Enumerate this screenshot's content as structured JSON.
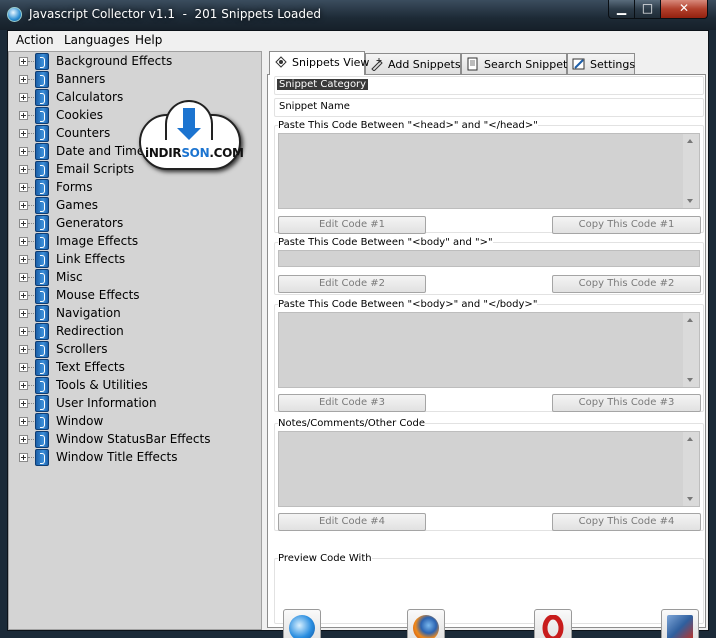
{
  "window": {
    "title": "Javascript Collector v1.1  -  201 Snippets Loaded",
    "minimize": "▁",
    "maximize": "□",
    "close": "✕"
  },
  "menu": [
    "Action",
    "Languages",
    "Help"
  ],
  "tree": {
    "items": [
      "Background Effects",
      "Banners",
      "Calculators",
      "Cookies",
      "Counters",
      "Date and Time",
      "Email Scripts",
      "Forms",
      "Games",
      "Generators",
      "Image Effects",
      "Link Effects",
      "Misc",
      "Mouse Effects",
      "Navigation",
      "Redirection",
      "Scrollers",
      "Text Effects",
      "Tools & Utilities",
      "User Information",
      "Window",
      "Window StatusBar Effects",
      "Window Title Effects"
    ]
  },
  "logo": {
    "part1": "iNDIR",
    "part2": "SON",
    "part3": ".COM"
  },
  "tabs": [
    "Snippets View",
    "Add Snippets",
    "Search Snippets",
    "Settings"
  ],
  "snippet": {
    "category_label": "Snippet Category",
    "name_label": "Snippet Name",
    "head_label": "Paste This Code Between \"<head>\" and \"</head>\"",
    "body_attr_label": "Paste This Code Between \"<body\" and \">\"",
    "body_label": "Paste This Code Between \"<body>\" and \"</body>\"",
    "notes_label": "Notes/Comments/Other Code"
  },
  "buttons": {
    "edit1": "Edit Code #1",
    "copy1": "Copy This Code #1",
    "edit2": "Edit Code #2",
    "copy2": "Copy This Code #2",
    "edit3": "Edit Code #3",
    "copy3": "Copy This Code #3",
    "edit4": "Edit Code #4",
    "copy4": "Copy This Code #4"
  },
  "preview": {
    "label": "Preview Code With",
    "browsers": [
      "internet-explorer-icon",
      "firefox-icon",
      "opera-icon",
      "netscape-icon"
    ]
  },
  "colors": {
    "tree_bg": "#d4d4d4",
    "code_area_bg": "#d2d2d2",
    "selected_label_bg": "#3a3a3a"
  }
}
